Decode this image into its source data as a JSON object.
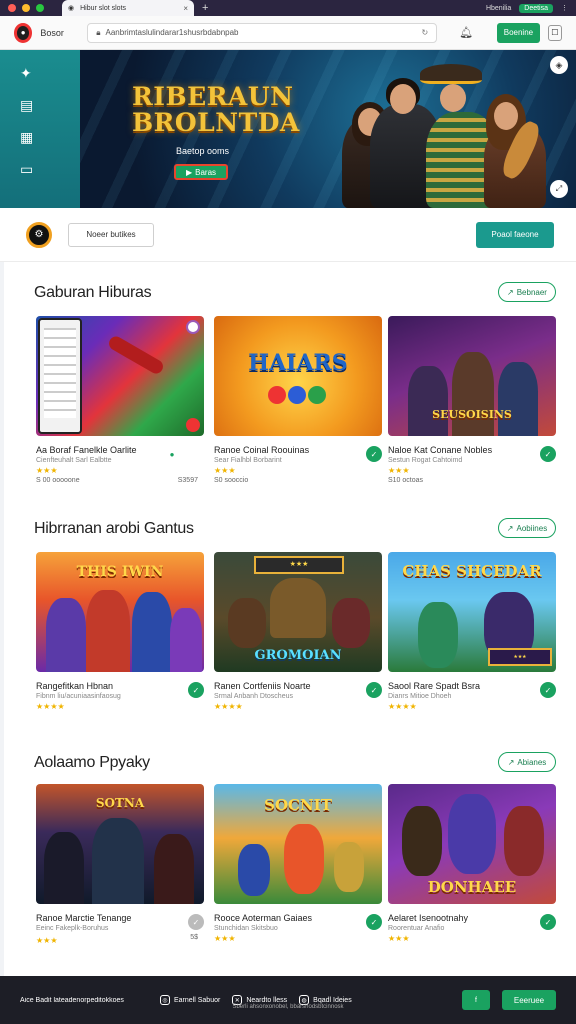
{
  "browser": {
    "tab_title": "Hibur slot slots",
    "right_text": "Hbenilia",
    "right_badge": "Deetisa"
  },
  "toolbar": {
    "brand": "Bosor",
    "url": "Aanbrimtaslulindarar1shusrbdabnpab",
    "signin_label": "Boenine"
  },
  "hero": {
    "title_line1": "RIBERAUN",
    "title_line2": "BROLNTDA",
    "subtitle": "Baetop ooms",
    "cta_label": "Baras"
  },
  "filter": {
    "input_value": "Noeer butikes",
    "button_label": "Poaol faeone"
  },
  "sections": [
    {
      "title": "Gaburan Hiburas",
      "link_label": "Bebnaer",
      "cards": [
        {
          "name": "Aa Boraf Fanelkle Oarlite",
          "meta": "Cienfteuhalt Sarl Ealbtte",
          "stars": "★★★",
          "foot_left": "S 00 ooooone",
          "foot_right": "S3597"
        },
        {
          "name": "Ranoe Coinal Roouinas",
          "meta": "Sear Fialhbl Borbarint",
          "stars": "★★★",
          "foot_left": "S0 sooccio",
          "foot_right": ""
        },
        {
          "name": "Naloe Kat Conane Nobles",
          "meta": "Sestun Rogat Cahtoimd",
          "stars": "★★★",
          "foot_left": "S10 octoas",
          "foot_right": ""
        }
      ],
      "thumb_titles": [
        "",
        "HAIARS",
        "SEUSOISINS"
      ]
    },
    {
      "title": "Hibrranan arobi Gantus",
      "link_label": "Aobiines",
      "cards": [
        {
          "name": "Rangefitkan Hbnan",
          "meta": "Fibnm liu/acuniaasinfaosug",
          "stars": "★★★★",
          "foot_left": "",
          "foot_right": ""
        },
        {
          "name": "Ranen Cortfeniis Noarte",
          "meta": "Srmal Anbanh Dtoscheus",
          "stars": "★★★★",
          "foot_left": "",
          "foot_right": ""
        },
        {
          "name": "Saool Rare Spadt Bsra",
          "meta": "Dianrs Mitioe Dhoeh",
          "stars": "★★★★",
          "foot_left": "",
          "foot_right": ""
        }
      ],
      "thumb_titles": [
        "THIS IWIN",
        "GROMOIAN",
        "CHAS SHCEDAR"
      ]
    },
    {
      "title": "Aolaamo Ppyaky",
      "link_label": "Abianes",
      "cards": [
        {
          "name": "Ranoe Marctie Tenange",
          "meta": "Eeinc Fakeplk-Boruhus",
          "stars": "★★★",
          "foot_left": "",
          "foot_right": "5$"
        },
        {
          "name": "Rooce Aoterman Gaiaes",
          "meta": "Stunchidan Skitsbuo",
          "stars": "★★★",
          "foot_left": "",
          "foot_right": ""
        },
        {
          "name": "Aelaret Isenootnahy",
          "meta": "Roorentuar Anafio",
          "stars": "★★★",
          "foot_left": "",
          "foot_right": ""
        }
      ],
      "thumb_titles": [
        "SOTNA",
        "SOCNIT",
        "DONHAEE"
      ]
    }
  ],
  "footer": {
    "copyright": "Aice Badit lateadenorpeditokkoes",
    "links": [
      "Earnell Sabuor",
      "Neardto lless",
      "Bqadl Ideies"
    ],
    "button_label": "Eeeruee",
    "subline": "Sberli ahsonxonobel, bbarshodsbtcinnosk"
  }
}
